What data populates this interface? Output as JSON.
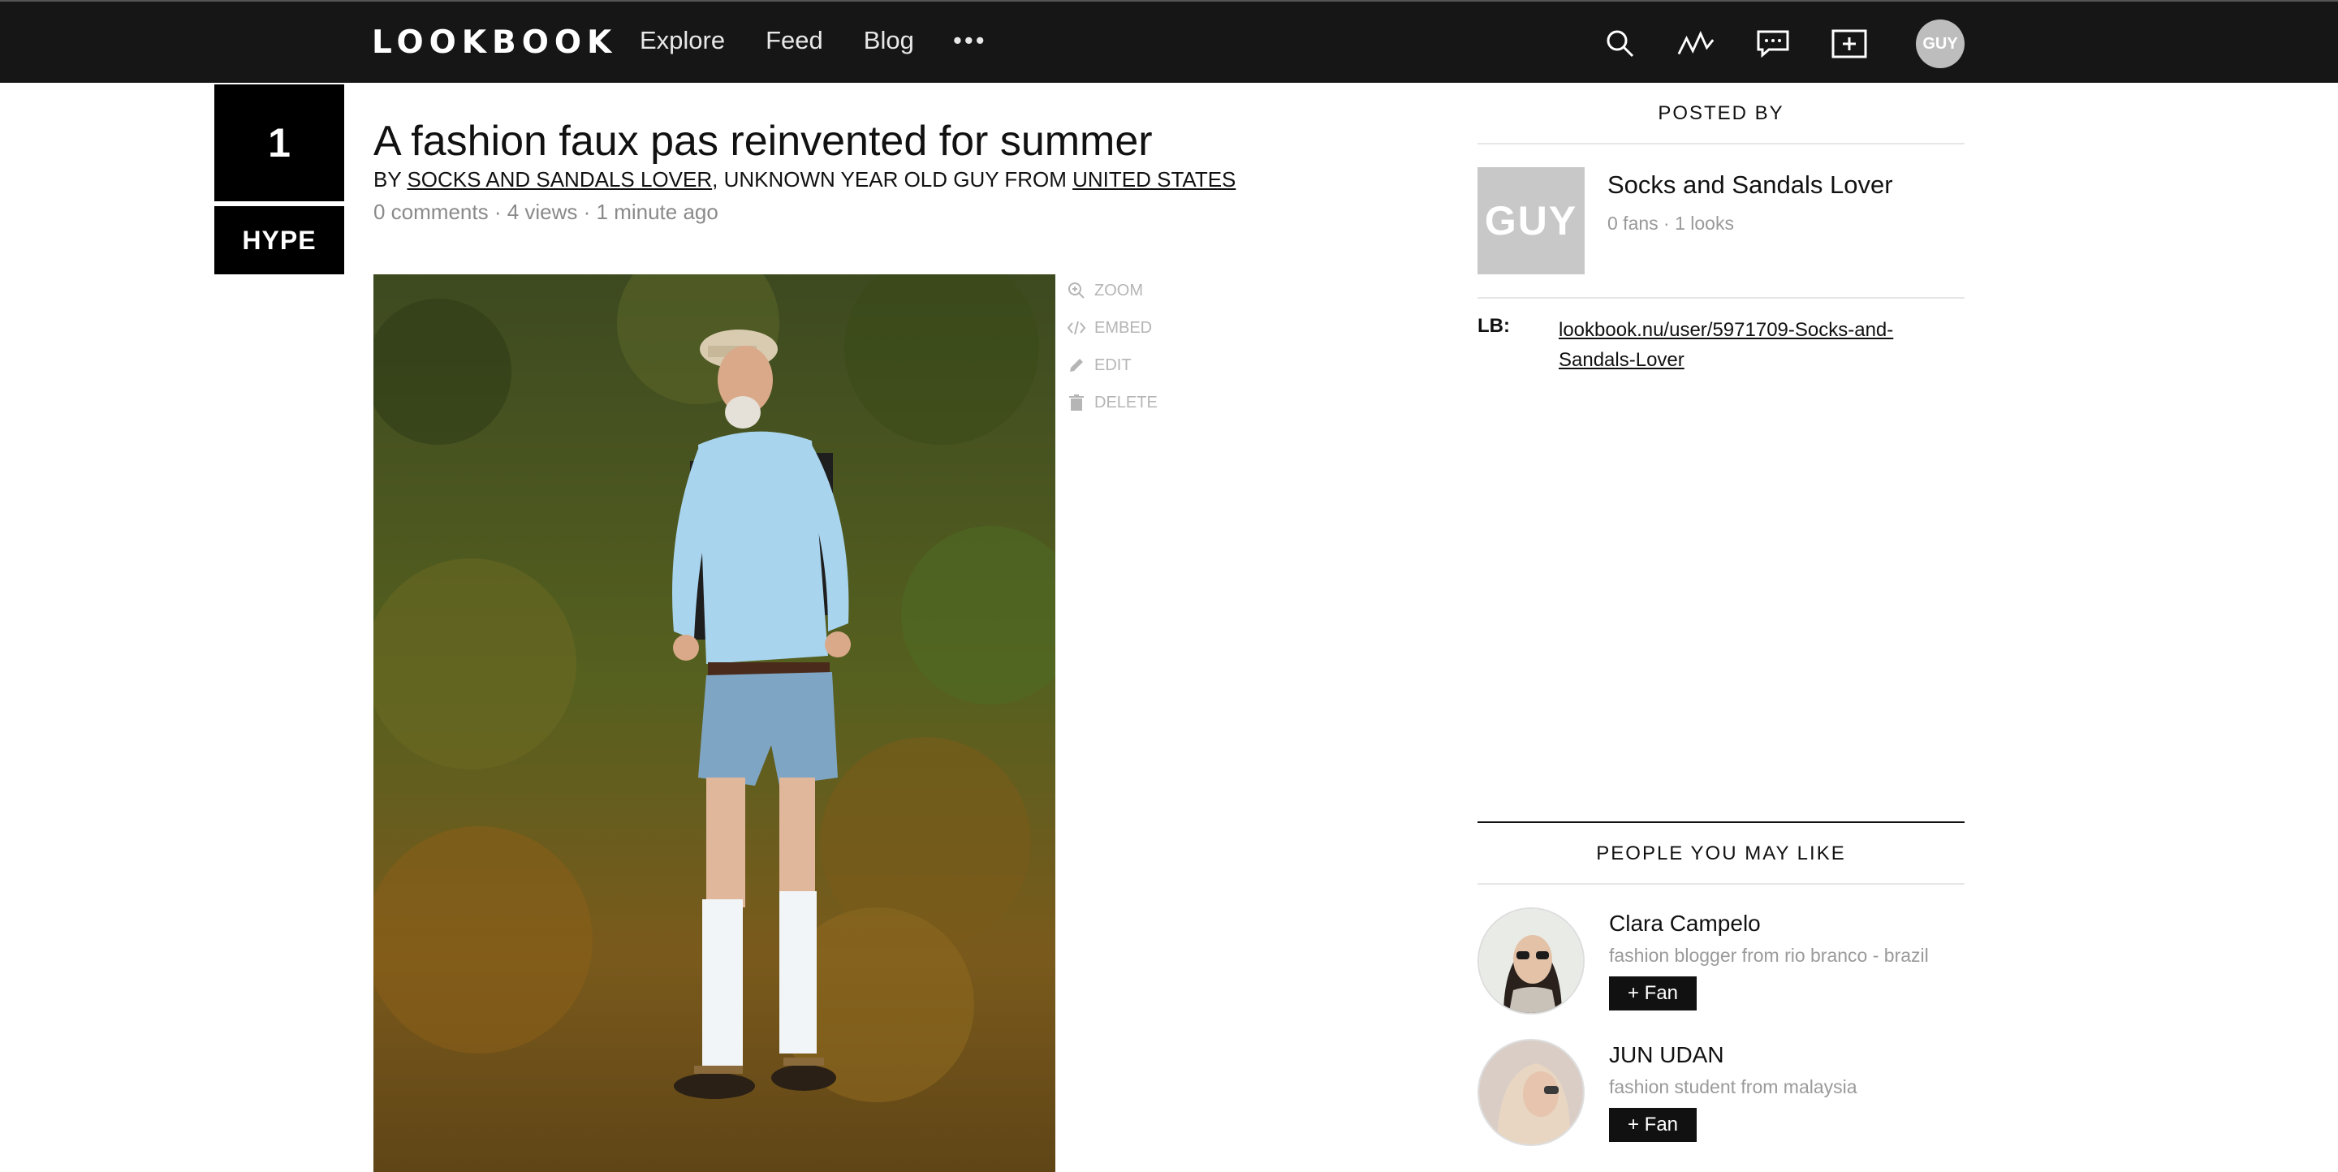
{
  "nav": {
    "logo": "LOOKBOOK",
    "links": [
      "Explore",
      "Feed",
      "Blog"
    ],
    "more": "•••",
    "avatar_text": "GUY",
    "icons": [
      "search-icon",
      "activity-icon",
      "messages-icon",
      "add-look-icon"
    ]
  },
  "hype": {
    "count": "1",
    "button": "HYPE"
  },
  "look": {
    "title": "A fashion faux pas reinvented for summer",
    "by_prefix": "BY ",
    "author_link": "SOCKS AND SANDALS LOVER",
    "by_middle": ", UNKNOWN YEAR OLD GUY FROM ",
    "country_link": "UNITED STATES",
    "meta": "0 comments · 4 views · 1 minute ago"
  },
  "actions": [
    {
      "label": "ZOOM",
      "icon": "zoom-icon"
    },
    {
      "label": "EMBED",
      "icon": "code-icon"
    },
    {
      "label": "EDIT",
      "icon": "pencil-icon"
    },
    {
      "label": "DELETE",
      "icon": "trash-icon"
    }
  ],
  "sidebar": {
    "posted_by_title": "POSTED BY",
    "author": {
      "avatar_text": "GUY",
      "name": "Socks and Sandals Lover",
      "stats": "0 fans · 1 looks"
    },
    "lb_label": "LB:",
    "lb_link": "lookbook.nu/user/5971709-Socks-and-Sandals-Lover"
  },
  "pymk": {
    "title": "PEOPLE YOU MAY LIKE",
    "people": [
      {
        "name": "Clara Campelo",
        "desc": "fashion blogger from rio branco - brazil",
        "fan": "+ Fan"
      },
      {
        "name": "JUN UDAN",
        "desc": "fashion student from malaysia",
        "fan": "+ Fan"
      }
    ]
  },
  "colors": {
    "nav_bg": "#161616",
    "hype_bg": "#000000",
    "muted": "#8a8a8a"
  }
}
